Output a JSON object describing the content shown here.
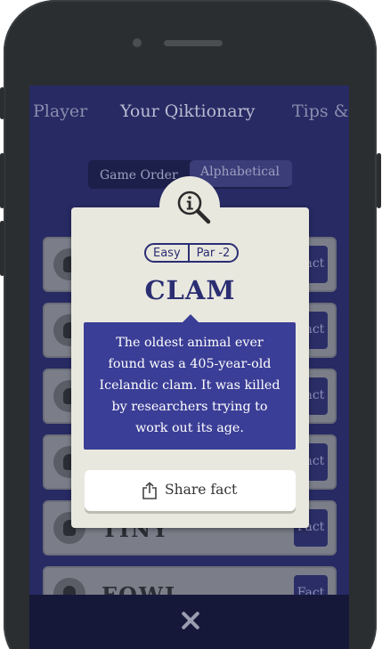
{
  "tabs": [
    {
      "label": "Player"
    },
    {
      "label": "Your Qiktionary"
    },
    {
      "label": "Tips &"
    }
  ],
  "sort_toggle": {
    "option_game_order": "Game Order",
    "option_alphabetical": "Alphabetical"
  },
  "list": {
    "fact_label": "Fact",
    "rows": [
      {
        "word": "",
        "fact": "Fact"
      },
      {
        "word": "",
        "fact": "Fact"
      },
      {
        "word": "",
        "fact": "Fact"
      },
      {
        "word": "",
        "fact": "Fact"
      },
      {
        "word": "TINY",
        "fact": "Fact"
      },
      {
        "word": "FOWL",
        "fact": "Fact"
      }
    ]
  },
  "modal": {
    "icon": "info-magnifier-icon",
    "difficulty": "Easy",
    "par": "Par -2",
    "word": "CLAM",
    "fact_lines": [
      "The oldest animal ever",
      "found was a 405-year-old",
      "Icelandic clam. It was killed",
      "by researchers trying to",
      "work out its age."
    ],
    "share_label": "Share fact",
    "share_icon": "share-icon"
  },
  "bottom_bar": {
    "close_icon": "close-icon"
  },
  "colors": {
    "screen_bg": "#272a63",
    "card_bg": "#e9e8df",
    "accent": "#3b3e96",
    "title": "#2b2e72"
  }
}
